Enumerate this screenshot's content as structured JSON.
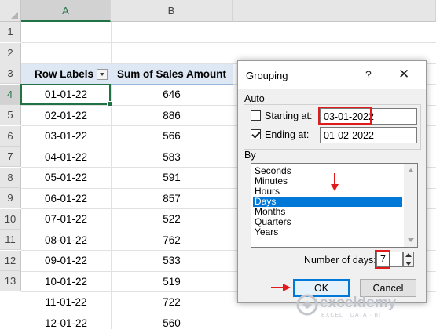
{
  "spreadsheet": {
    "columns": [
      "A",
      "B"
    ],
    "rows": [
      "1",
      "2",
      "3",
      "4",
      "5",
      "6",
      "7",
      "8",
      "9",
      "10",
      "11",
      "12",
      "13"
    ],
    "headers": {
      "row_labels": "Row Labels",
      "sum_label": "Sum of Sales Amount"
    },
    "data": [
      {
        "date": "01-01-22",
        "amount": "646"
      },
      {
        "date": "02-01-22",
        "amount": "886"
      },
      {
        "date": "03-01-22",
        "amount": "566"
      },
      {
        "date": "04-01-22",
        "amount": "583"
      },
      {
        "date": "05-01-22",
        "amount": "591"
      },
      {
        "date": "06-01-22",
        "amount": "857"
      },
      {
        "date": "07-01-22",
        "amount": "522"
      },
      {
        "date": "08-01-22",
        "amount": "762"
      },
      {
        "date": "09-01-22",
        "amount": "533"
      },
      {
        "date": "10-01-22",
        "amount": "519"
      },
      {
        "date": "11-01-22",
        "amount": "722"
      },
      {
        "date": "12-01-22",
        "amount": "560"
      }
    ]
  },
  "dialog": {
    "title": "Grouping",
    "help": "?",
    "close": "✕",
    "auto_label": "Auto",
    "starting_label": "Starting at:",
    "starting_value": "03-01-2022",
    "starting_checked": false,
    "ending_label": "Ending at:",
    "ending_value": "01-02-2022",
    "ending_checked": true,
    "by_label": "By",
    "by_items": [
      "Seconds",
      "Minutes",
      "Hours",
      "Days",
      "Months",
      "Quarters",
      "Years"
    ],
    "by_selected": "Days",
    "num_days_label": "Number of days:",
    "num_days_value": "7",
    "ok_label": "OK",
    "cancel_label": "Cancel"
  },
  "watermark": {
    "name": "exceldemy",
    "tagline": "EXCEL · DATA · BI"
  },
  "colors": {
    "accent_green": "#217346",
    "selection_blue": "#0078d7",
    "highlight_red": "#e01b1b"
  }
}
